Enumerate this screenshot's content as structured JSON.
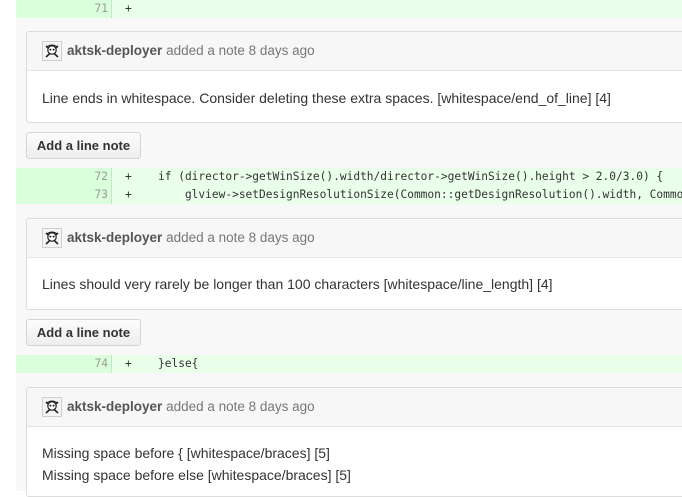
{
  "diff_lines": [
    {
      "number": "71",
      "sign": "+",
      "code": ""
    },
    {
      "number": "72",
      "sign": "+",
      "code": "if (director->getWinSize().width/director->getWinSize().height > 2.0/3.0) {"
    },
    {
      "number": "73",
      "sign": "+",
      "code": "    glview->setDesignResolutionSize(Common::getDesignResolution().width, Common"
    },
    {
      "number": "74",
      "sign": "+",
      "code": "}else{"
    }
  ],
  "notes": [
    {
      "author": "aktsk-deployer",
      "action": "added a note 8 days ago",
      "lines": [
        "Line ends in whitespace. Consider deleting these extra spaces. [whitespace/end_of_line] [4]"
      ]
    },
    {
      "author": "aktsk-deployer",
      "action": "added a note 8 days ago",
      "lines": [
        "Lines should very rarely be longer than 100 characters [whitespace/line_length] [4]"
      ]
    },
    {
      "author": "aktsk-deployer",
      "action": "added a note 8 days ago",
      "lines": [
        "Missing space before { [whitespace/braces] [5]",
        "Missing space before else [whitespace/braces] [5]"
      ]
    }
  ],
  "buttons": {
    "add_line_note": "Add a line note"
  },
  "icons": {
    "avatar": "pirate-skull-avatar-icon"
  },
  "colors": {
    "added_line_bg": "#eaffea",
    "added_gutter_bg": "#dbffdb",
    "note_header_bg": "#f7f7f7"
  }
}
